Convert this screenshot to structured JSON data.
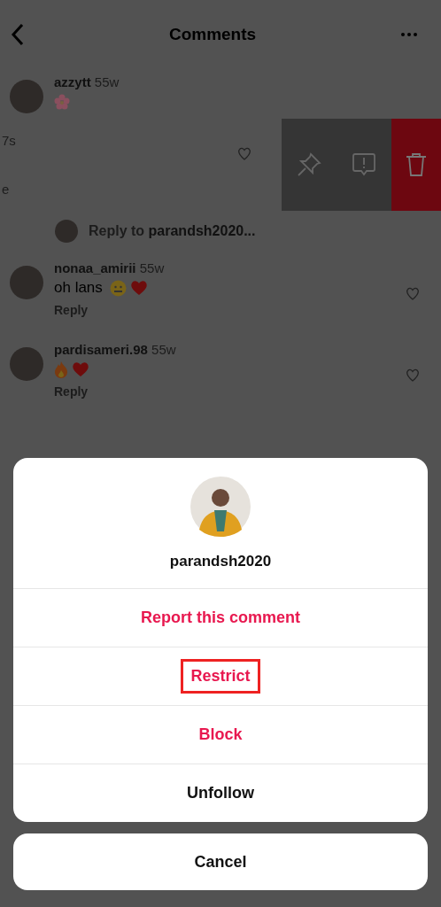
{
  "header": {
    "title": "Comments"
  },
  "comments": [
    {
      "kind": "comment",
      "username": "azzytt",
      "time": "55w",
      "emojis": [
        {
          "kind": "flower"
        }
      ]
    },
    {
      "kind": "swiped",
      "time": "7s",
      "text": "e",
      "liked": false,
      "actions": [
        {
          "kind": "pin"
        },
        {
          "kind": "report"
        },
        {
          "kind": "delete"
        }
      ]
    },
    {
      "kind": "reply_prompt",
      "prefix": "Reply to ",
      "username": "parandsh2020..."
    },
    {
      "kind": "comment",
      "username": "nonaa_amirii",
      "time": "55w",
      "text": "oh lans",
      "emojis": [
        {
          "kind": "face"
        },
        {
          "kind": "heart"
        }
      ],
      "reply": "Reply",
      "liked": false
    },
    {
      "kind": "comment",
      "username": "pardisameri.98",
      "time": "55w",
      "emojis": [
        {
          "kind": "fire"
        },
        {
          "kind": "heart"
        }
      ],
      "reply": "Reply",
      "liked": false
    }
  ],
  "sheet": {
    "username": "parandsh2020",
    "options": [
      {
        "label": "Report this comment",
        "kind": "danger",
        "highlighted": false
      },
      {
        "label": "Restrict",
        "kind": "danger",
        "highlighted": true
      },
      {
        "label": "Block",
        "kind": "danger",
        "highlighted": false
      },
      {
        "label": "Unfollow",
        "kind": "normal",
        "highlighted": false
      }
    ],
    "cancel": "Cancel"
  }
}
